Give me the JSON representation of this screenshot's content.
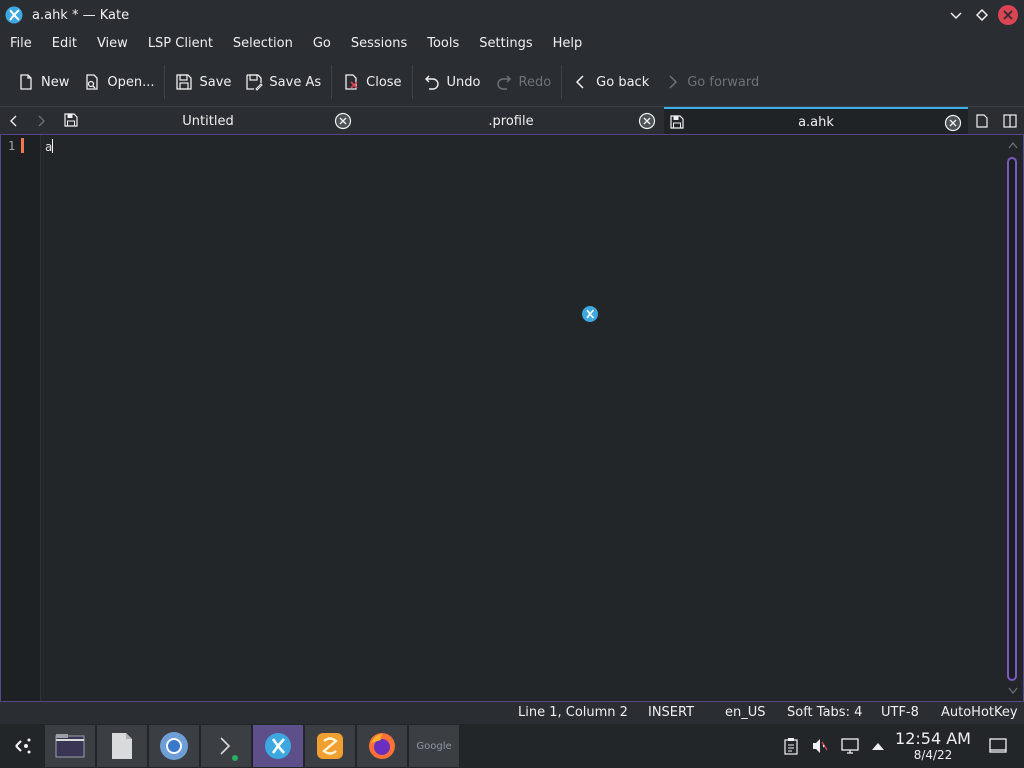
{
  "window": {
    "title": "a.ahk * — Kate",
    "app_icon": "kate-icon",
    "controls": [
      "minimize-icon",
      "maximize-icon",
      "close-icon"
    ]
  },
  "menubar": {
    "items": [
      "File",
      "Edit",
      "View",
      "LSP Client",
      "Selection",
      "Go",
      "Sessions",
      "Tools",
      "Settings",
      "Help"
    ]
  },
  "toolbar": {
    "new_label": "New",
    "open_label": "Open...",
    "save_label": "Save",
    "save_as_label": "Save As",
    "close_label": "Close",
    "undo_label": "Undo",
    "redo_label": "Redo",
    "go_back_label": "Go back",
    "go_forward_label": "Go forward"
  },
  "tabs": [
    {
      "label": "Untitled",
      "active": false,
      "has_save_icon": true
    },
    {
      "label": ".profile",
      "active": false,
      "has_save_icon": false
    },
    {
      "label": "a.ahk",
      "active": true,
      "has_save_icon": true
    }
  ],
  "editor": {
    "lines": [
      {
        "number": "1",
        "text": "a"
      }
    ]
  },
  "statusbar": {
    "position": "Line 1, Column 2",
    "mode": "INSERT",
    "language": "en_US",
    "indentation": "Soft Tabs: 4",
    "encoding": "UTF-8",
    "syntax": "AutoHotKey"
  },
  "taskbar": {
    "launcher_icon": "application-launcher-icon",
    "apps": [
      "file-manager-icon",
      "document-icon",
      "chromium-icon",
      "terminal-icon",
      "kate-icon",
      "sublime-icon",
      "firefox-icon",
      "google-icon"
    ],
    "google_text": "Google",
    "tray": [
      "clipboard-icon",
      "volume-muted-icon",
      "network-icon",
      "expand-tray-icon"
    ],
    "clock": {
      "time": "12:54 AM",
      "date": "8/4/22"
    },
    "show_desktop_icon": "show-desktop-icon"
  },
  "colors": {
    "accent": "#3daee9",
    "selection_border": "#56478b",
    "line_marker": "#f47750",
    "close_button": "#da4453",
    "active_task": "#5c4f8a"
  }
}
